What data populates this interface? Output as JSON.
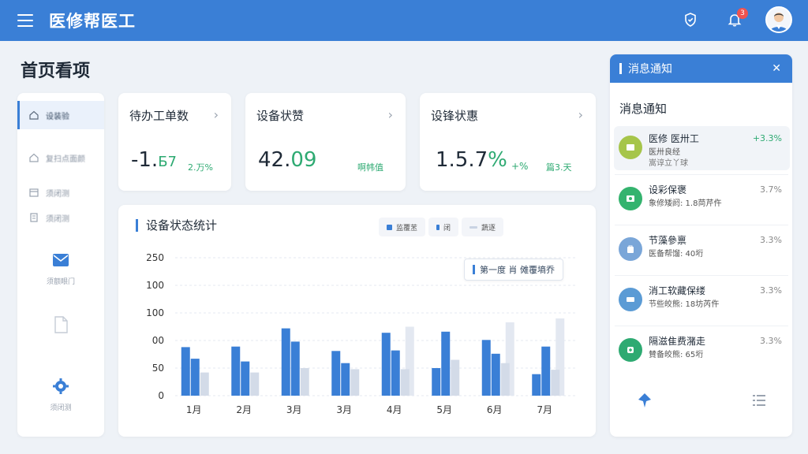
{
  "header": {
    "app_title": "医修帮医工",
    "notification_count": "3"
  },
  "page": {
    "title": "首页看项"
  },
  "sidebar": {
    "items": [
      {
        "label": "设装验",
        "icon": "home-icon",
        "active": true
      },
      {
        "label": "复扫点面颜",
        "icon": "home-icon"
      },
      {
        "label": "须闭测",
        "icon": "calendar-icon"
      },
      {
        "label": "须闭测",
        "icon": "document-icon"
      }
    ],
    "big_items": [
      {
        "label": "须额眼门",
        "icon": "mail-icon"
      },
      {
        "label": "",
        "icon": "file-icon"
      },
      {
        "label": "须闭测",
        "icon": "gear-icon"
      }
    ]
  },
  "kpis": [
    {
      "title": "待办工单数",
      "value_main": "-1.",
      "value_accent": "Б7",
      "sub": "2.万%",
      "arrow": "›"
    },
    {
      "title": "设备状赞",
      "value_main": "42.",
      "value_accent": "09",
      "sub": "啊帏值",
      "arrow": "›"
    },
    {
      "title": "设锋状惠",
      "value_main": "1.5.7",
      "value_accent": "%",
      "extra": "+%",
      "sub": "篇3.天",
      "arrow": "›"
    }
  ],
  "chart_panel": {
    "title": "设备状态统计",
    "legend": [
      {
        "label": "监覆苤",
        "color": "#3a7fd6"
      },
      {
        "label": "闭",
        "color": "#3a7fd6"
      },
      {
        "label": "蔬逐",
        "color": "#c9d3e3"
      }
    ],
    "tooltip": "第一度  肖 傩覆墒乔"
  },
  "chart_data": {
    "type": "bar",
    "categories": [
      "1月",
      "2月",
      "3月",
      "3月",
      "4月",
      "5月",
      "6月",
      "7月"
    ],
    "ytick_labels": [
      "250",
      "100",
      "100",
      "00",
      "50",
      "0"
    ],
    "series": [
      {
        "values": [
          88,
          89,
          122,
          81,
          114,
          50,
          101,
          39
        ]
      },
      {
        "values": [
          67,
          62,
          98,
          59,
          82,
          116,
          76,
          89
        ]
      },
      {
        "values": [
          42,
          42,
          50,
          48,
          48,
          65,
          59,
          47
        ]
      },
      {
        "values": [
          0,
          0,
          0,
          0,
          125,
          0,
          133,
          140
        ]
      }
    ],
    "ylim": [
      0,
      250
    ],
    "grid": true
  },
  "notifications": {
    "header_title": "消息通知",
    "subtitle": "消息通知",
    "items": [
      {
        "title": "医修  医卅工",
        "line2": "医卅良经",
        "line3": "嵩谆立丫球",
        "value": "+3.3%",
        "up": true,
        "icon_color": "#a6c54a",
        "icon": "tool-icon"
      },
      {
        "title": "设彩保褒",
        "line2": "象修矮阏: 1.8苘芹仵",
        "line3": "",
        "value": "3.7%",
        "up": false,
        "icon_color": "#34b36e",
        "icon": "device-icon"
      },
      {
        "title": "节藻參禀",
        "line2": "医备帮馏: 40垳",
        "line3": "",
        "value": "3.3%",
        "up": false,
        "icon_color": "#7aa6d8",
        "icon": "bag-icon"
      },
      {
        "title": "消工软藏保缕",
        "line2": "节些皎熊: 18坊芮仵",
        "line3": "",
        "value": "3.3%",
        "up": false,
        "icon_color": "#5b9bd5",
        "icon": "truck-icon"
      },
      {
        "title": "隔滋隹费潴走",
        "line2": "賛备皎熊: 65垳",
        "line3": "",
        "value": "3.3%",
        "up": false,
        "icon_color": "#2eaa72",
        "icon": "medical-icon"
      }
    ],
    "footer": {
      "left_icon": "pin-icon",
      "right_icon": "list-icon"
    }
  },
  "colors": {
    "primary": "#3a7fd6",
    "success": "#2eaa72",
    "bar_light": "#c9d3e3"
  }
}
